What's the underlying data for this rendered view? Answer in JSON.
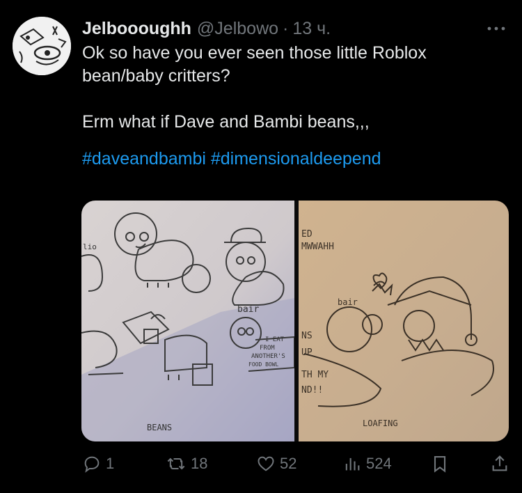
{
  "post": {
    "author_name": "Jelboooughh",
    "author_handle": "@Jelbowo",
    "separator": "·",
    "timestamp": "13 ч.",
    "text_line1": "Ok so have you ever seen those little Roblox bean/baby critters?",
    "text_line2": "Erm what if Dave and Bambi beans,,,",
    "hashtag1": "#daveandbambi",
    "hashtag2": "#dimensionaldeepend"
  },
  "media": {
    "left_image": {
      "sketch_texts": [
        "bair",
        "I EAT",
        "FROM",
        "ANOTHER'S",
        "FOOD BOWL",
        "BEANS",
        "lio"
      ]
    },
    "right_image": {
      "sketch_texts": [
        "ED",
        "MWWAHH",
        "bair",
        "NS",
        "UP",
        "TH MY",
        "ND!!",
        "LOAFING"
      ]
    }
  },
  "actions": {
    "replies": "1",
    "reposts": "18",
    "likes": "52",
    "views": "524"
  },
  "colors": {
    "background": "#000000",
    "text": "#e7e9ea",
    "muted": "#71767b",
    "link": "#1d9bf0"
  },
  "icons": [
    "more-icon",
    "reply-icon",
    "repost-icon",
    "like-icon",
    "views-icon",
    "bookmark-icon",
    "share-icon"
  ]
}
